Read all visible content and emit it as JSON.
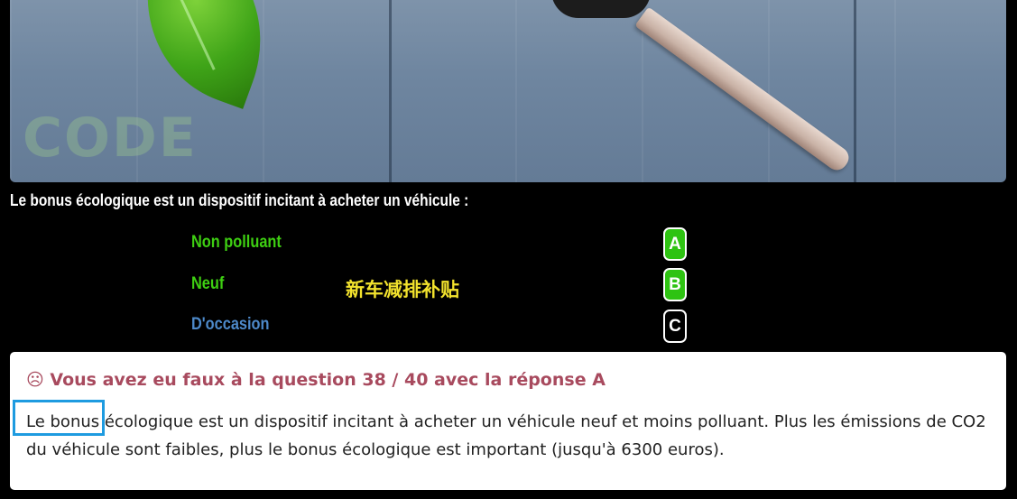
{
  "hero": {
    "image_name": "green-leaf-and-car-key-on-wood",
    "watermark": "CODE"
  },
  "question": {
    "text": "Le bonus écologique est un dispositif incitant à acheter un véhicule :"
  },
  "answers": [
    {
      "label": "Non polluant",
      "letter": "A",
      "color": "#3ecf12"
    },
    {
      "label": "Neuf",
      "letter": "B",
      "color": "#3ecf12"
    },
    {
      "label": "D'occasion",
      "letter": "C",
      "color": "#4d89c9"
    }
  ],
  "translation": "新车减排补贴",
  "result": {
    "icon": "sad-face-icon",
    "heading": "☹ Vous avez eu faux à la question 38 / 40 avec la réponse A",
    "explanation": "Le bonus écologique est un dispositif incitant à acheter un véhicule neuf et moins polluant. Plus les émissions de CO2 du véhicule sont faibles, plus le bonus écologique est important (jusqu'à 6300 euros)."
  },
  "colors": {
    "correct": "#2ec312",
    "heading": "#a84a5e",
    "highlight": "#1e9be0",
    "translation": "#f2e22d"
  }
}
